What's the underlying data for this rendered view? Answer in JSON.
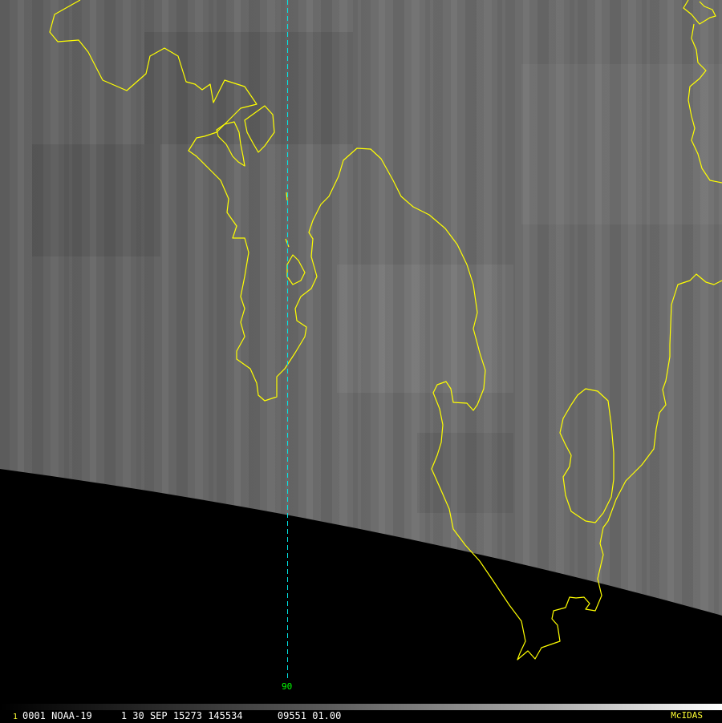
{
  "satellite_image": {
    "meridian_label": "90",
    "colors": {
      "coastline": "#ffff00",
      "meridian": "#00e5e5",
      "meridian_label": "#00ff00",
      "background": "#000000"
    }
  },
  "status_bar": {
    "frame_number": "1",
    "info_line": "0001 NOAA-19     1 30 SEP 15273 145534      09551 01.00",
    "brand": "McIDAS",
    "colors": {
      "frame_number": "#ffff33",
      "info_text": "#ffffff",
      "brand": "#ffff33"
    }
  }
}
